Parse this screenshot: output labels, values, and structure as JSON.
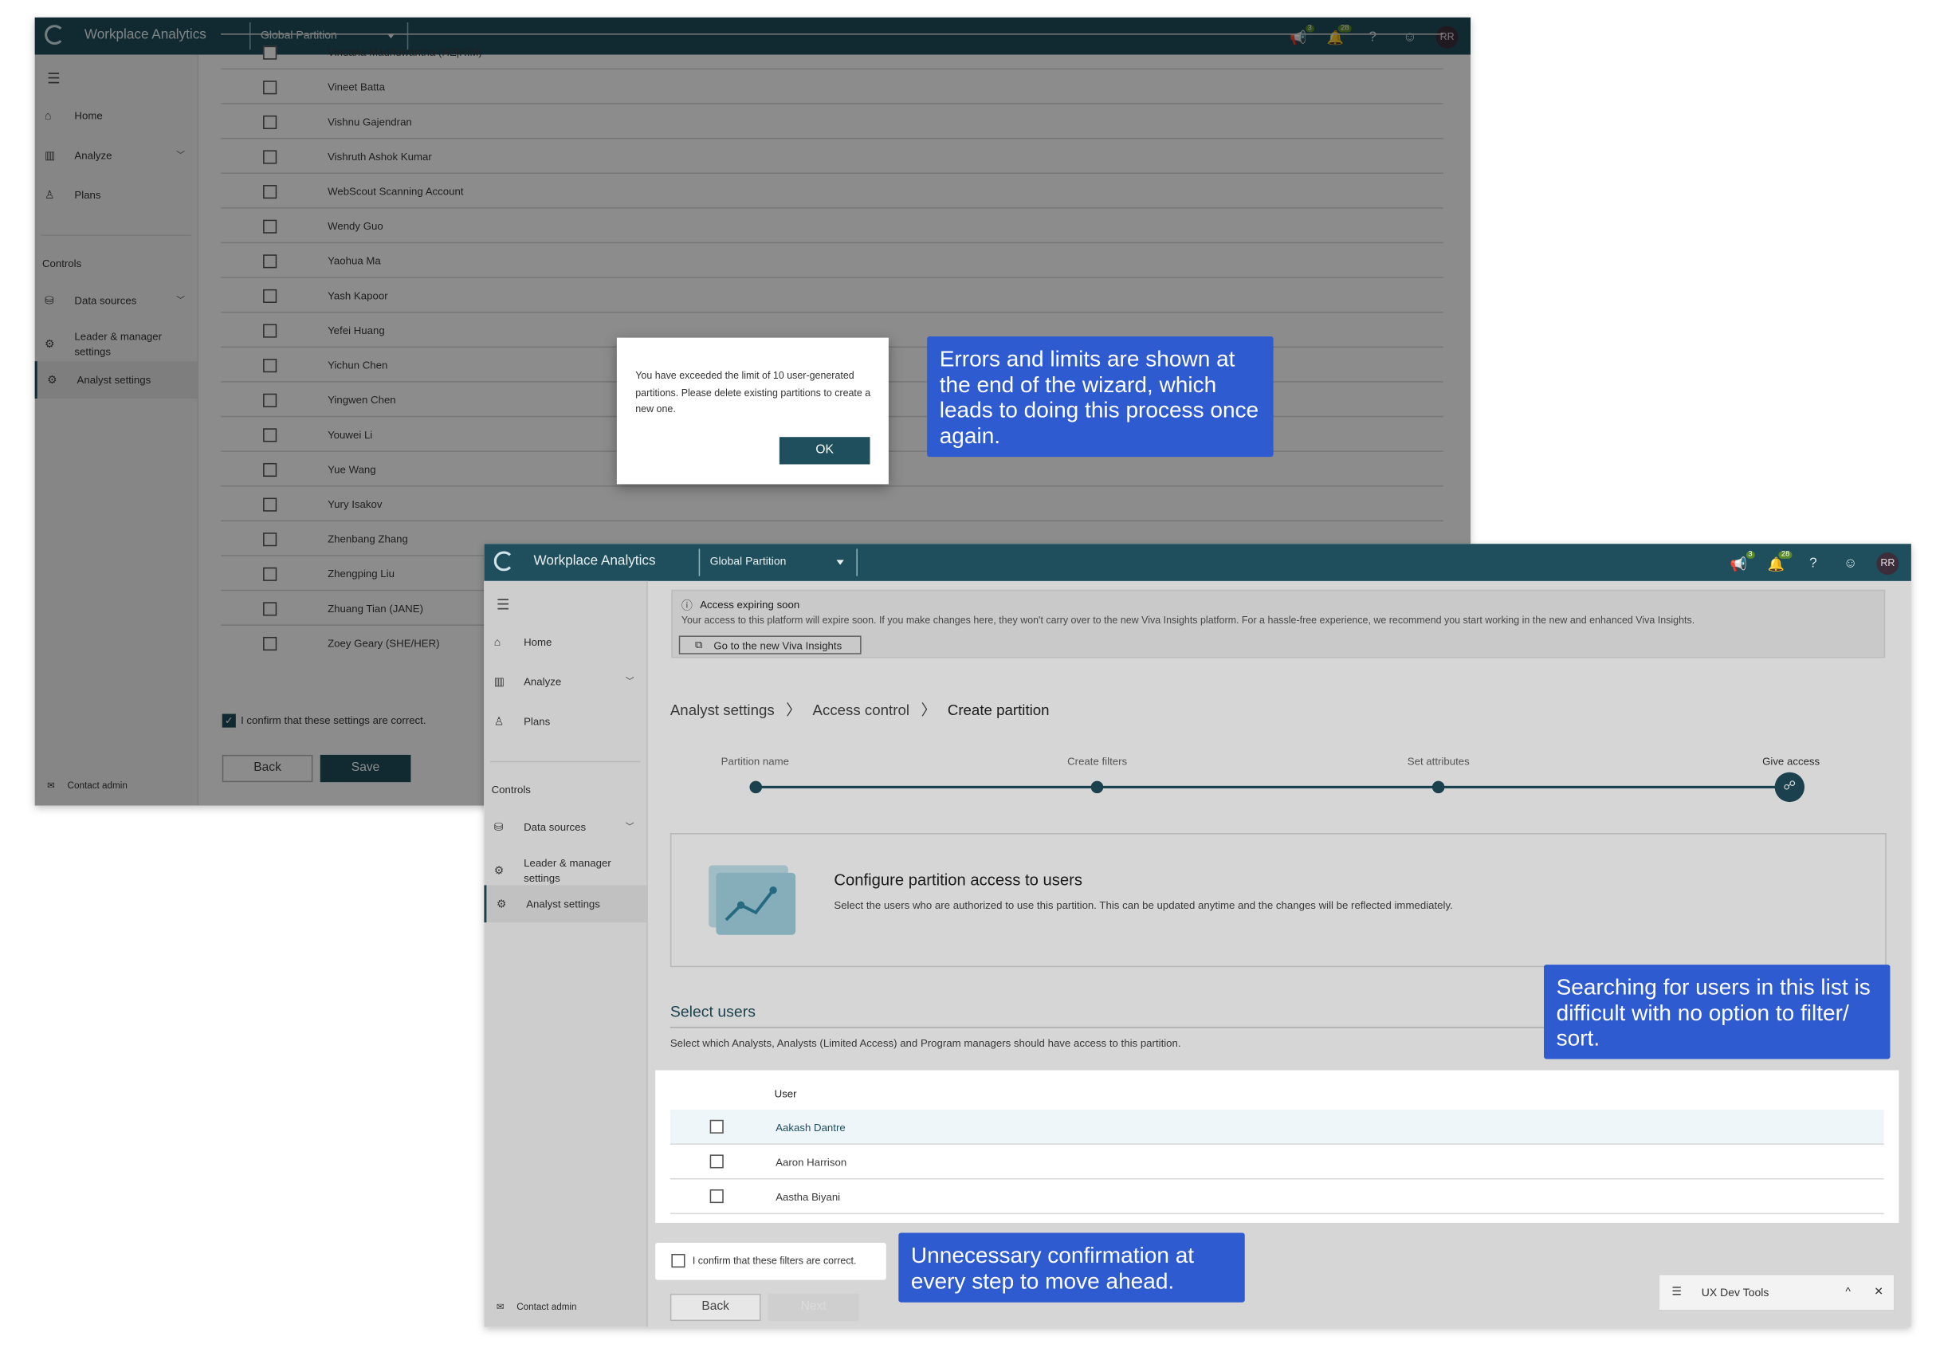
{
  "app": {
    "name": "Workplace Analytics",
    "partition": "Global Partition",
    "notif1": "3",
    "notif2": "28",
    "help": "?",
    "feedback": "☺",
    "user_initials": "RR"
  },
  "nav": {
    "menu_icon": "☰",
    "home": "Home",
    "analyze": "Analyze",
    "plans": "Plans",
    "controls": "Controls",
    "data_sources": "Data sources",
    "leader1": "Leader & manager",
    "leader2": "settings",
    "analyst": "Analyst settings",
    "contact": "Contact admin"
  },
  "back_window": {
    "users": [
      "Vindana Madhuwantha (HE|HIM)",
      "Vineet Batta",
      "Vishnu Gajendran",
      "Vishruth Ashok Kumar",
      "WebScout Scanning Account",
      "Wendy Guo",
      "Yaohua Ma",
      "Yash Kapoor",
      "Yefei Huang",
      "Yichun Chen",
      "Yingwen Chen",
      "Youwei Li",
      "Yue Wang",
      "Yury Isakov",
      "Zhenbang Zhang",
      "Zhengping Liu",
      "Zhuang Tian (JANE)",
      "Zoey Geary (SHE/HER)"
    ],
    "confirm": "I confirm that these settings are correct.",
    "back": "Back",
    "save": "Save"
  },
  "dialog": {
    "message": "You have exceeded the limit of 10 user-generated partitions. Please delete existing partitions to create a new one.",
    "ok": "OK"
  },
  "front_window": {
    "banner_title": "Access expiring soon",
    "banner_text": "Your access to this platform will expire soon. If you make changes here, they won't carry over to the new Viva Insights platform. For a hassle-free experience, we recommend you start working in the new and enhanced Viva Insights.",
    "banner_button": "Go to the new Viva Insights",
    "breadcrumb": [
      "Analyst settings",
      "Access control",
      "Create partition"
    ],
    "steps": [
      "Partition name",
      "Create filters",
      "Set attributes",
      "Give access"
    ],
    "card_title": "Configure partition access to users",
    "card_desc": "Select the users who are authorized to use this partition. This can be updated anytime and the changes will be reflected immediately.",
    "select_title": "Select users",
    "select_desc": "Select which Analysts, Analysts (Limited Access) and Program managers should have access to this partition.",
    "table_header": "User",
    "users": [
      "Aakash Dantre",
      "Aaron Harrison",
      "Aastha Biyani"
    ],
    "confirm": "I confirm that these filters are correct.",
    "back": "Back",
    "next": "Next"
  },
  "callouts": {
    "errors": "Errors and limits are shown at the end of the wizard, which leads to doing this process once again.",
    "search": "Searching for users in this list is difficult with no option to filter/ sort.",
    "confirm": "Unnecessary confirmation at every step to move ahead."
  },
  "devtools": {
    "label": "UX Dev Tools",
    "expand": "^",
    "close": "✕"
  },
  "colors": {
    "topbar": "#1f4e5c",
    "callout": "#2f5bd1",
    "accent": "#1f4e5c"
  }
}
